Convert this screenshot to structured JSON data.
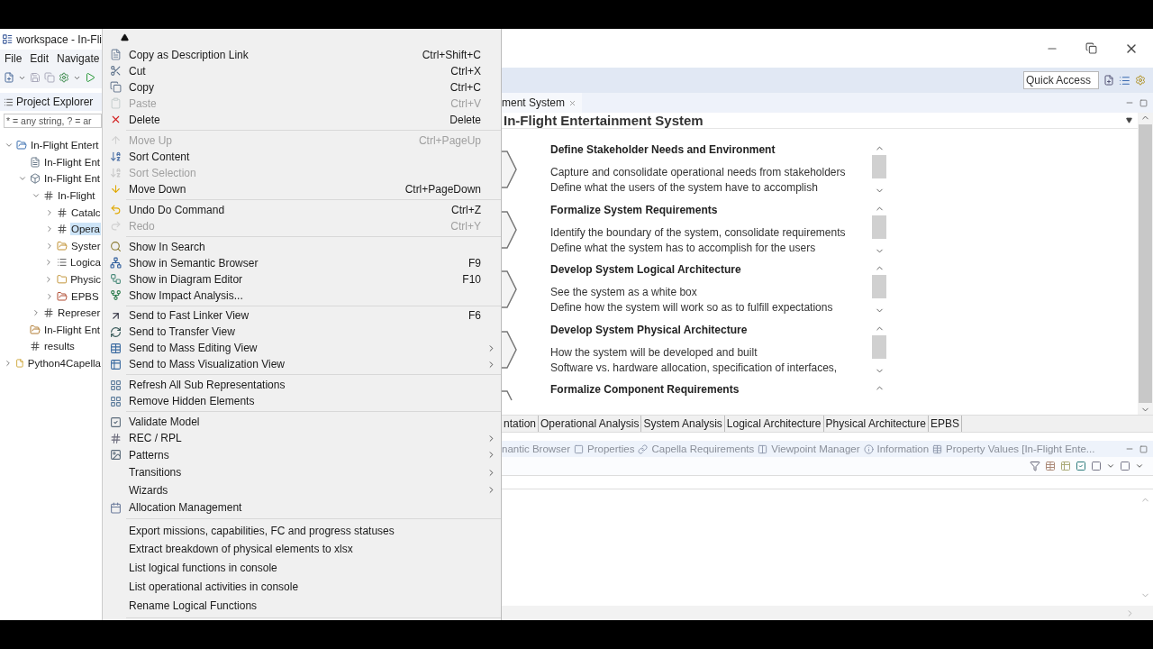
{
  "window": {
    "title": "workspace - In-Fli"
  },
  "menubar": [
    "File",
    "Edit",
    "Navigate"
  ],
  "project_explorer": {
    "title": "Project Explorer",
    "filter": {
      "placeholder": "* = any string, ? = ar"
    },
    "tree": [
      {
        "label": "In-Flight Entert",
        "expanded": true,
        "selected": false,
        "children": [
          {
            "label": "In-Flight Ent",
            "selected": false
          },
          {
            "label": "In-Flight Ent",
            "expanded": true,
            "selected": false,
            "children": [
              {
                "label": "In-Flight",
                "expanded": true,
                "selected": false,
                "children": [
                  {
                    "label": "Catalc",
                    "expanded": false,
                    "selected": false
                  },
                  {
                    "label": "Opera",
                    "expanded": false,
                    "selected": true
                  },
                  {
                    "label": "Syster",
                    "expanded": false,
                    "selected": false
                  },
                  {
                    "label": "Logica",
                    "expanded": false,
                    "selected": false
                  },
                  {
                    "label": "Physic",
                    "expanded": false,
                    "selected": false
                  },
                  {
                    "label": "EPBS",
                    "expanded": false,
                    "selected": false
                  }
                ]
              },
              {
                "label": "Represer",
                "expanded": false,
                "selected": false
              }
            ]
          },
          {
            "label": "In-Flight Ent",
            "selected": false
          },
          {
            "label": "results",
            "selected": false
          }
        ]
      },
      {
        "label": "Python4Capella",
        "expanded": false,
        "selected": false
      }
    ]
  },
  "context_menu": {
    "sections": [
      [
        {
          "label": "Copy as Description Link",
          "shortcut": "Ctrl+Shift+C",
          "disabled": false,
          "submenu": false
        },
        {
          "label": "Cut",
          "shortcut": "Ctrl+X",
          "disabled": false,
          "submenu": false
        },
        {
          "label": "Copy",
          "shortcut": "Ctrl+C",
          "disabled": false,
          "submenu": false
        },
        {
          "label": "Paste",
          "shortcut": "Ctrl+V",
          "disabled": true,
          "submenu": false
        },
        {
          "label": "Delete",
          "shortcut": "Delete",
          "disabled": false,
          "submenu": false
        }
      ],
      [
        {
          "label": "Move Up",
          "shortcut": "Ctrl+PageUp",
          "disabled": true,
          "submenu": false
        },
        {
          "label": "Sort Content",
          "disabled": false,
          "submenu": false
        },
        {
          "label": "Sort Selection",
          "disabled": true,
          "submenu": false
        },
        {
          "label": "Move Down",
          "shortcut": "Ctrl+PageDown",
          "disabled": false,
          "submenu": false
        }
      ],
      [
        {
          "label": "Undo Do Command",
          "shortcut": "Ctrl+Z",
          "disabled": false,
          "submenu": false
        },
        {
          "label": "Redo",
          "shortcut": "Ctrl+Y",
          "disabled": true,
          "submenu": false
        }
      ],
      [
        {
          "label": "Show In Search",
          "disabled": false,
          "submenu": false
        },
        {
          "label": "Show in Semantic Browser",
          "shortcut": "F9",
          "disabled": false,
          "submenu": false
        },
        {
          "label": "Show in Diagram Editor",
          "shortcut": "F10",
          "disabled": false,
          "submenu": false
        },
        {
          "label": "Show Impact Analysis...",
          "disabled": false,
          "submenu": false
        }
      ],
      [
        {
          "label": "Send to Fast Linker View",
          "shortcut": "F6",
          "disabled": false,
          "submenu": false
        },
        {
          "label": "Send to Transfer View",
          "disabled": false,
          "submenu": false
        },
        {
          "label": "Send to Mass Editing View",
          "disabled": false,
          "submenu": true
        },
        {
          "label": "Send to Mass Visualization View",
          "disabled": false,
          "submenu": true
        }
      ],
      [
        {
          "label": "Refresh All Sub Representations",
          "disabled": false,
          "submenu": false
        },
        {
          "label": "Remove Hidden Elements",
          "disabled": false,
          "submenu": false
        }
      ],
      [
        {
          "label": "Validate Model",
          "disabled": false,
          "submenu": false
        },
        {
          "label": "REC / RPL",
          "disabled": false,
          "submenu": true
        },
        {
          "label": "Patterns",
          "disabled": false,
          "submenu": true
        },
        {
          "label": "Transitions",
          "disabled": false,
          "submenu": true
        },
        {
          "label": "Wizards",
          "disabled": false,
          "submenu": true
        },
        {
          "label": "Allocation Management",
          "disabled": false,
          "submenu": false
        }
      ],
      [
        {
          "label": "Export missions, capabilities, FC and progress statuses",
          "disabled": false,
          "submenu": false
        },
        {
          "label": "Extract breakdown of physical elements to xlsx",
          "disabled": false,
          "submenu": false
        },
        {
          "label": "List logical functions in console",
          "disabled": false,
          "submenu": false
        },
        {
          "label": "List operational activities in console",
          "disabled": false,
          "submenu": false
        },
        {
          "label": "Rename Logical Functions",
          "disabled": false,
          "submenu": false
        }
      ]
    ]
  },
  "toolbar": {
    "quick_access": {
      "placeholder": "Quick Access"
    }
  },
  "editor": {
    "tab": "ment System",
    "title": "In-Flight Entertainment System",
    "steps": [
      {
        "title": "Define Stakeholder Needs and Environment",
        "lines": [
          "Capture and consolidate operational needs from stakeholders",
          "Define what the users of the system have to accomplish"
        ]
      },
      {
        "title": "Formalize System Requirements",
        "lines": [
          "Identify the boundary of the system, consolidate requirements",
          "Define what the system has to accomplish for the users"
        ]
      },
      {
        "title": "Develop System Logical Architecture",
        "lines": [
          "See the system as a white box",
          "Define how the system will work so as to fulfill expectations"
        ]
      },
      {
        "title": "Develop System Physical Architecture",
        "lines": [
          "How the system will be developed and built",
          "Software vs. hardware allocation, specification of interfaces,"
        ]
      },
      {
        "title": "Formalize Component Requirements"
      }
    ],
    "tabs": [
      "ntation",
      "Operational Analysis",
      "System Analysis",
      "Logical Architecture",
      "Physical Architecture",
      "EPBS"
    ]
  },
  "views": {
    "tabs": [
      "nantic Browser",
      "Properties",
      "Capella Requirements",
      "Viewpoint Manager",
      "Information",
      "Property Values [In-Flight Ente..."
    ]
  }
}
